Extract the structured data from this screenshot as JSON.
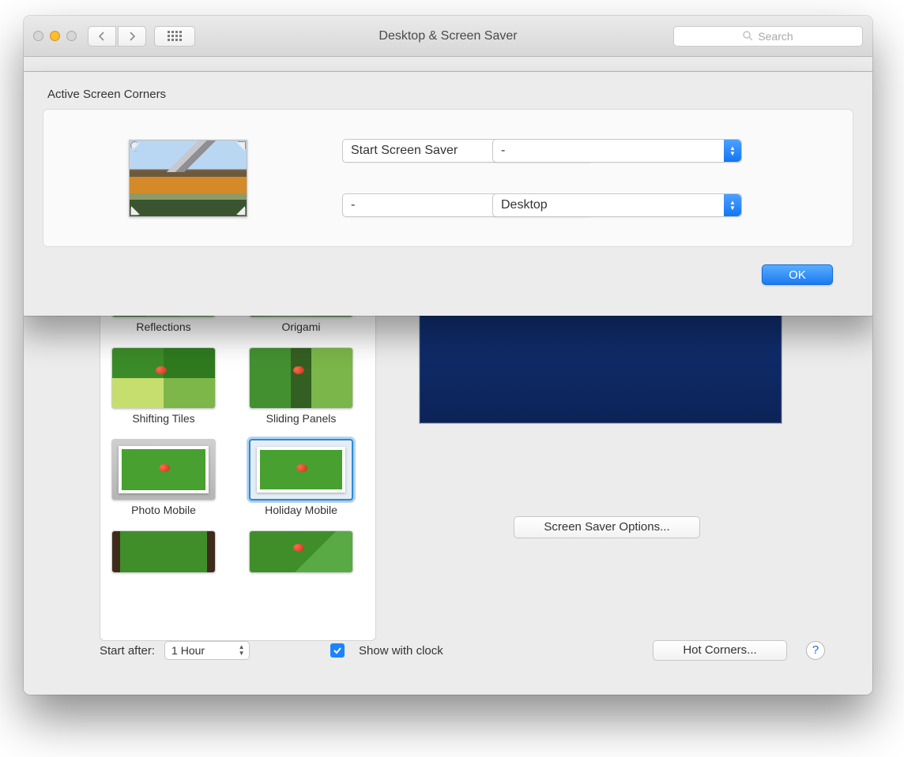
{
  "window": {
    "title": "Desktop & Screen Saver",
    "search_placeholder": "Search"
  },
  "sheet": {
    "title": "Active Screen Corners",
    "top_left": "Start Screen Saver",
    "top_right": "-",
    "bottom_left": "-",
    "bottom_right": "Desktop",
    "ok": "OK"
  },
  "savers": {
    "items": [
      {
        "label": "Reflections"
      },
      {
        "label": "Origami"
      },
      {
        "label": "Shifting Tiles"
      },
      {
        "label": "Sliding Panels"
      },
      {
        "label": "Photo Mobile"
      },
      {
        "label": "Holiday Mobile"
      }
    ]
  },
  "options_button": "Screen Saver Options...",
  "footer": {
    "start_label": "Start after:",
    "start_value": "1 Hour",
    "clock_label": "Show with clock",
    "hot_corners": "Hot Corners...",
    "help": "?"
  }
}
